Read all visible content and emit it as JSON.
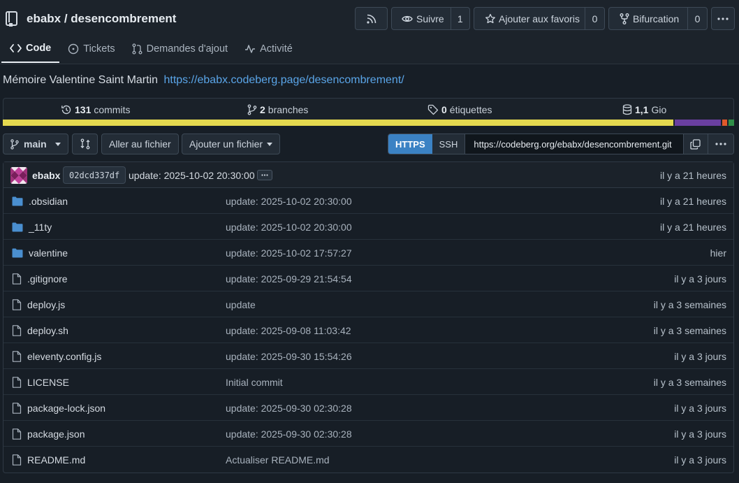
{
  "repo": {
    "full_name": "ebabx / desencombrement"
  },
  "header_buttons": {
    "rss_icon": "rss-icon",
    "watch": {
      "label": "Suivre",
      "count": "1"
    },
    "star": {
      "label": "Ajouter aux favoris",
      "count": "0"
    },
    "fork": {
      "label": "Bifurcation",
      "count": "0"
    }
  },
  "tabs": [
    {
      "label": "Code",
      "icon": "code-icon",
      "active": true
    },
    {
      "label": "Tickets",
      "icon": "issue-icon",
      "active": false
    },
    {
      "label": "Demandes d'ajout",
      "icon": "pull-request-icon",
      "active": false
    },
    {
      "label": "Activité",
      "icon": "pulse-icon",
      "active": false
    }
  ],
  "description": {
    "text": "Mémoire Valentine Saint Martin",
    "link": "https://ebabx.codeberg.page/desencombrement/"
  },
  "stats": {
    "commits": {
      "value": "131",
      "label": "commits"
    },
    "branches": {
      "value": "2",
      "label": "branches"
    },
    "tags": {
      "value": "0",
      "label": "étiquettes"
    },
    "size": {
      "value": "1,1",
      "label": "Gio"
    }
  },
  "language_bar": [
    {
      "color": "#e5d94f",
      "share": 92.2
    },
    {
      "color": "#6a3fa0",
      "share": 6.4
    },
    {
      "color": "#e0592a",
      "share": 0.6
    },
    {
      "color": "#2f8f48",
      "share": 0.8
    }
  ],
  "toolbar": {
    "branch": "main",
    "goto_file": "Aller au fichier",
    "add_file": "Ajouter un fichier",
    "clone_https": "HTTPS",
    "clone_ssh": "SSH",
    "clone_url": "https://codeberg.org/ebabx/desencombrement.git"
  },
  "latest_commit": {
    "author": "ebabx",
    "sha": "02dcd337df",
    "message": "update: 2025-10-02 20:30:00",
    "time": "il y a 21 heures"
  },
  "files": [
    {
      "name": ".obsidian",
      "type": "folder",
      "message": "update: 2025-10-02 20:30:00",
      "time": "il y a 21 heures"
    },
    {
      "name": "_11ty",
      "type": "folder",
      "message": "update: 2025-10-02 20:30:00",
      "time": "il y a 21 heures"
    },
    {
      "name": "valentine",
      "type": "folder",
      "message": "update: 2025-10-02 17:57:27",
      "time": "hier"
    },
    {
      "name": ".gitignore",
      "type": "file",
      "message": "update: 2025-09-29 21:54:54",
      "time": "il y a 3 jours"
    },
    {
      "name": "deploy.js",
      "type": "file",
      "message": "update",
      "time": "il y a 3 semaines"
    },
    {
      "name": "deploy.sh",
      "type": "file",
      "message": "update: 2025-09-08 11:03:42",
      "time": "il y a 3 semaines"
    },
    {
      "name": "eleventy.config.js",
      "type": "file",
      "message": "update: 2025-09-30 15:54:26",
      "time": "il y a 3 jours"
    },
    {
      "name": "LICENSE",
      "type": "file",
      "message": "Initial commit",
      "time": "il y a 3 semaines"
    },
    {
      "name": "package-lock.json",
      "type": "file",
      "message": "update: 2025-09-30 02:30:28",
      "time": "il y a 3 jours"
    },
    {
      "name": "package.json",
      "type": "file",
      "message": "update: 2025-09-30 02:30:28",
      "time": "il y a 3 jours"
    },
    {
      "name": "README.md",
      "type": "file",
      "message": "Actualiser README.md",
      "time": "il y a 3 jours"
    }
  ]
}
